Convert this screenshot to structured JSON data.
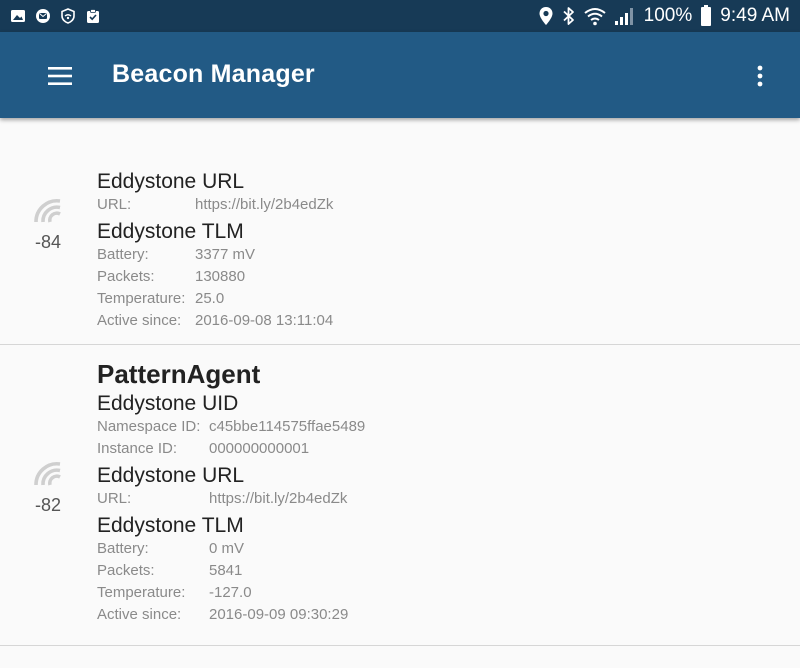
{
  "status_bar": {
    "left_icons": [
      "image-icon",
      "message-icon",
      "shield-wifi-icon",
      "clipboard-check-icon"
    ],
    "right_icons": [
      "location-icon",
      "bluetooth-icon",
      "wifi-icon",
      "cell-signal-icon",
      "battery-icon"
    ],
    "battery": "100%",
    "time": "9:49 AM"
  },
  "app_bar": {
    "title": "Beacon Manager",
    "menu_icon": "hamburger-menu-icon",
    "overflow_icon": "more-vertical-icon"
  },
  "colors": {
    "status_bar": "#173a56",
    "app_bar": "#225a85",
    "background": "#fafafa",
    "label_text": "#8a8a8a",
    "title_text": "#222222"
  },
  "beacons": [
    {
      "rssi": "-84",
      "frames": [
        {
          "title": "Eddystone URL",
          "fields": [
            {
              "key": "URL:",
              "value": "https://bit.ly/2b4edZk"
            }
          ]
        },
        {
          "title": "Eddystone TLM",
          "fields": [
            {
              "key": "Battery:",
              "value": "3377 mV"
            },
            {
              "key": "Packets:",
              "value": "130880"
            },
            {
              "key": "Temperature:",
              "value": "25.0"
            },
            {
              "key": "Active since:",
              "value": "2016-09-08 13:11:04"
            }
          ]
        }
      ]
    },
    {
      "name": "PatternAgent",
      "rssi": "-82",
      "frames": [
        {
          "title": "Eddystone UID",
          "fields": [
            {
              "key": "Namespace ID:",
              "value": "c45bbe114575ffae5489"
            },
            {
              "key": "Instance ID:",
              "value": "000000000001"
            }
          ]
        },
        {
          "title": "Eddystone URL",
          "fields": [
            {
              "key": "URL:",
              "value": "https://bit.ly/2b4edZk"
            }
          ]
        },
        {
          "title": "Eddystone TLM",
          "fields": [
            {
              "key": "Battery:",
              "value": "0 mV"
            },
            {
              "key": "Packets:",
              "value": "5841"
            },
            {
              "key": "Temperature:",
              "value": "-127.0"
            },
            {
              "key": "Active since:",
              "value": "2016-09-09 09:30:29"
            }
          ]
        }
      ]
    }
  ]
}
